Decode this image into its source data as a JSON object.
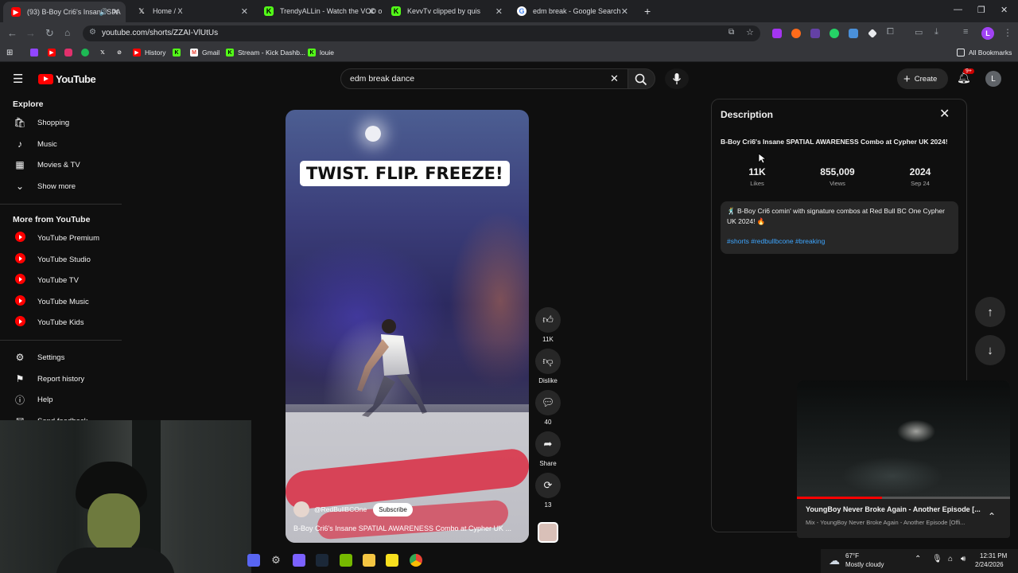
{
  "browser": {
    "tabs": [
      {
        "title": "(93) B-Boy Cri6's Insane SPA",
        "icon": "youtube-icon",
        "color": "#ff0000"
      },
      {
        "title": "Home / X",
        "icon": "x-icon",
        "color": "#ffffff"
      },
      {
        "title": "TrendyALLin - Watch the VOD o",
        "icon": "kick-icon",
        "color": "#53fc18"
      },
      {
        "title": "KevvTv clipped by quis",
        "icon": "kick-icon",
        "color": "#53fc18"
      },
      {
        "title": "edm break - Google Search",
        "icon": "google-icon",
        "color": "#4285f4"
      }
    ],
    "url": "youtube.com/shorts/ZZAI-VlUtUs",
    "bookmarks": [
      "History",
      "Gmail",
      "Stream - Kick Dashb...",
      "louie"
    ],
    "all_bookmarks": "All Bookmarks",
    "profile_initial": "L"
  },
  "youtube": {
    "logo_text": "YouTube",
    "search_query": "edm break dance",
    "create_label": "Create",
    "notification_count": "9+",
    "avatar_initial": "L"
  },
  "sidebar": {
    "explore_heading": "Explore",
    "explore_items": [
      {
        "label": "Shopping",
        "icon": "shopping-bag-icon"
      },
      {
        "label": "Music",
        "icon": "music-note-icon"
      },
      {
        "label": "Movies & TV",
        "icon": "film-icon"
      },
      {
        "label": "Show more",
        "icon": "chevron-down-icon"
      }
    ],
    "more_heading": "More from YouTube",
    "more_items": [
      {
        "label": "YouTube Premium"
      },
      {
        "label": "YouTube Studio"
      },
      {
        "label": "YouTube TV"
      },
      {
        "label": "YouTube Music"
      },
      {
        "label": "YouTube Kids"
      }
    ],
    "settings_items": [
      {
        "label": "Settings",
        "icon": "gear-icon"
      },
      {
        "label": "Report history",
        "icon": "flag-icon"
      },
      {
        "label": "Help",
        "icon": "help-icon"
      },
      {
        "label": "Send feedback",
        "icon": "feedback-icon"
      }
    ]
  },
  "short": {
    "overlay_caption": "TWIST. FLIP. FREEZE!",
    "channel": "@RedBullBCOne",
    "subscribe": "Subscribe",
    "title": "B-Boy Cri6's Insane SPATIAL AWARENESS Combo at Cypher UK ...",
    "actions": [
      {
        "icon": "thumbs-up-icon",
        "label": "11K"
      },
      {
        "icon": "thumbs-down-icon",
        "label": "Dislike"
      },
      {
        "icon": "comment-icon",
        "label": "40"
      },
      {
        "icon": "share-icon",
        "label": "Share"
      },
      {
        "icon": "remix-icon",
        "label": "13"
      }
    ]
  },
  "description": {
    "heading": "Description",
    "video_title": "B-Boy Cri6's Insane SPATIAL AWARENESS Combo at Cypher UK 2024!",
    "stats": [
      {
        "value": "11K",
        "label": "Likes"
      },
      {
        "value": "855,009",
        "label": "Views"
      },
      {
        "value": "2024",
        "label": "Sep 24"
      }
    ],
    "text": "🕺 B-Boy Cri6 comin' with signature combos at Red Bull BC One Cypher UK 2024! 🔥",
    "tags": "#shorts #redbullbcone #breaking"
  },
  "miniplayer": {
    "title": "YoungBoy Never Broke Again - Another Episode [...",
    "subtitle": "Mix - YoungBoy Never Broke Again - Another Episode [Offi...",
    "progress": 0.4
  },
  "taskbar": {
    "weather_temp": "67°F",
    "weather_desc": "Mostly cloudy",
    "time": "12:31 PM",
    "date": "2/24/2026"
  }
}
